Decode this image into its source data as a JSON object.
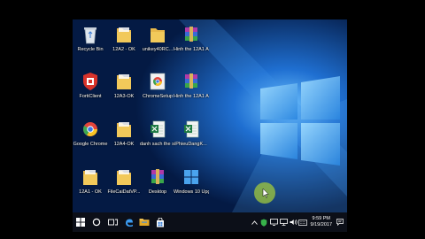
{
  "desktop": {
    "icons": [
      {
        "label": "Recycle Bin",
        "icon": "recycle-bin-icon"
      },
      {
        "label": "12A2 - OK",
        "icon": "folder-icon"
      },
      {
        "label": "unikey40RC...",
        "icon": "folder-icon"
      },
      {
        "label": "Hinh the 12A1 A2 - 2016-20...",
        "icon": "rar-archive-icon"
      },
      {
        "label": "FortiClient",
        "icon": "forticlient-icon"
      },
      {
        "label": "12A3-OK",
        "icon": "folder-icon"
      },
      {
        "label": "ChromeSetup",
        "icon": "chrome-setup-icon"
      },
      {
        "label": "Hinh the 12A1 A4 - 2016-20...",
        "icon": "rar-archive-icon"
      },
      {
        "label": "Google Chrome",
        "icon": "chrome-icon"
      },
      {
        "label": "12A4-OK",
        "icon": "folder-icon"
      },
      {
        "label": "danh sach the sinh",
        "icon": "excel-file-icon"
      },
      {
        "label": "PhieuDangK...",
        "icon": "excel-file-icon"
      },
      {
        "label": "12A1 - OK",
        "icon": "folder-icon"
      },
      {
        "label": "FileCaiDatVP...",
        "icon": "folder-icon"
      },
      {
        "label": "Desktop",
        "icon": "rar-archive-icon"
      },
      {
        "label": "Windows 10 Upgrade ...",
        "icon": "windows-upgrade-icon"
      }
    ]
  },
  "taskbar": {
    "time": "9:59 PM",
    "date": "9/19/2017"
  },
  "colors": {
    "taskbar": "#0c0f18",
    "folder": "#f2c95a",
    "accent_blue": "#2b78d8"
  }
}
